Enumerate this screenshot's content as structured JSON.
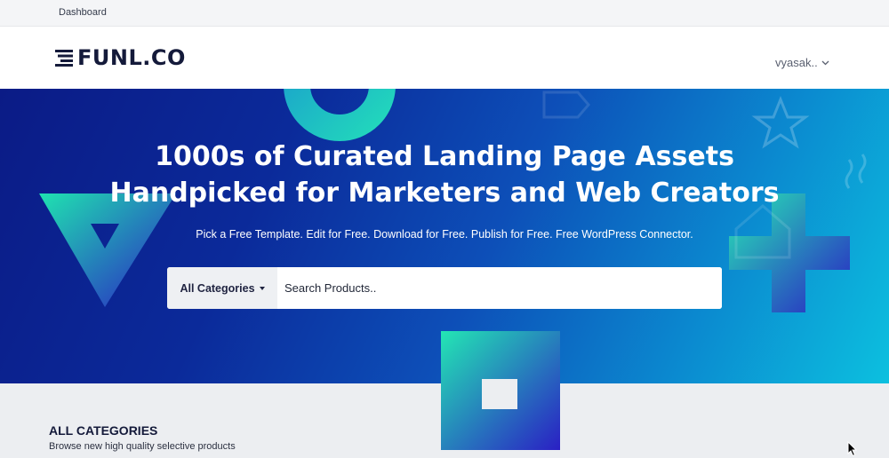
{
  "topbar": {
    "dashboard_link": "Dashboard"
  },
  "navbar": {
    "logo_text": "FUNL.CO",
    "user_menu_label": "vyasak..",
    "user_menu_icon": "chevron-down-icon"
  },
  "hero": {
    "title_line1": "1000s of Curated Landing Page Assets",
    "title_line2": "Handpicked for Marketers and Web Creators",
    "subtitle": "Pick a Free Template. Edit for Free. Download for Free. Publish for Free. Free WordPress Connector.",
    "search": {
      "category_label": "All Categories",
      "placeholder": "Search Products.."
    }
  },
  "categories_section": {
    "title": "ALL CATEGORIES",
    "subtitle": "Browse new high quality selective products"
  },
  "colors": {
    "hero_gradient_start": "#0b1b86",
    "hero_gradient_end": "#0cc0df",
    "accent_teal": "#1fe3b0",
    "accent_purple": "#2a1fc4",
    "brand_dark": "#141a3a"
  }
}
